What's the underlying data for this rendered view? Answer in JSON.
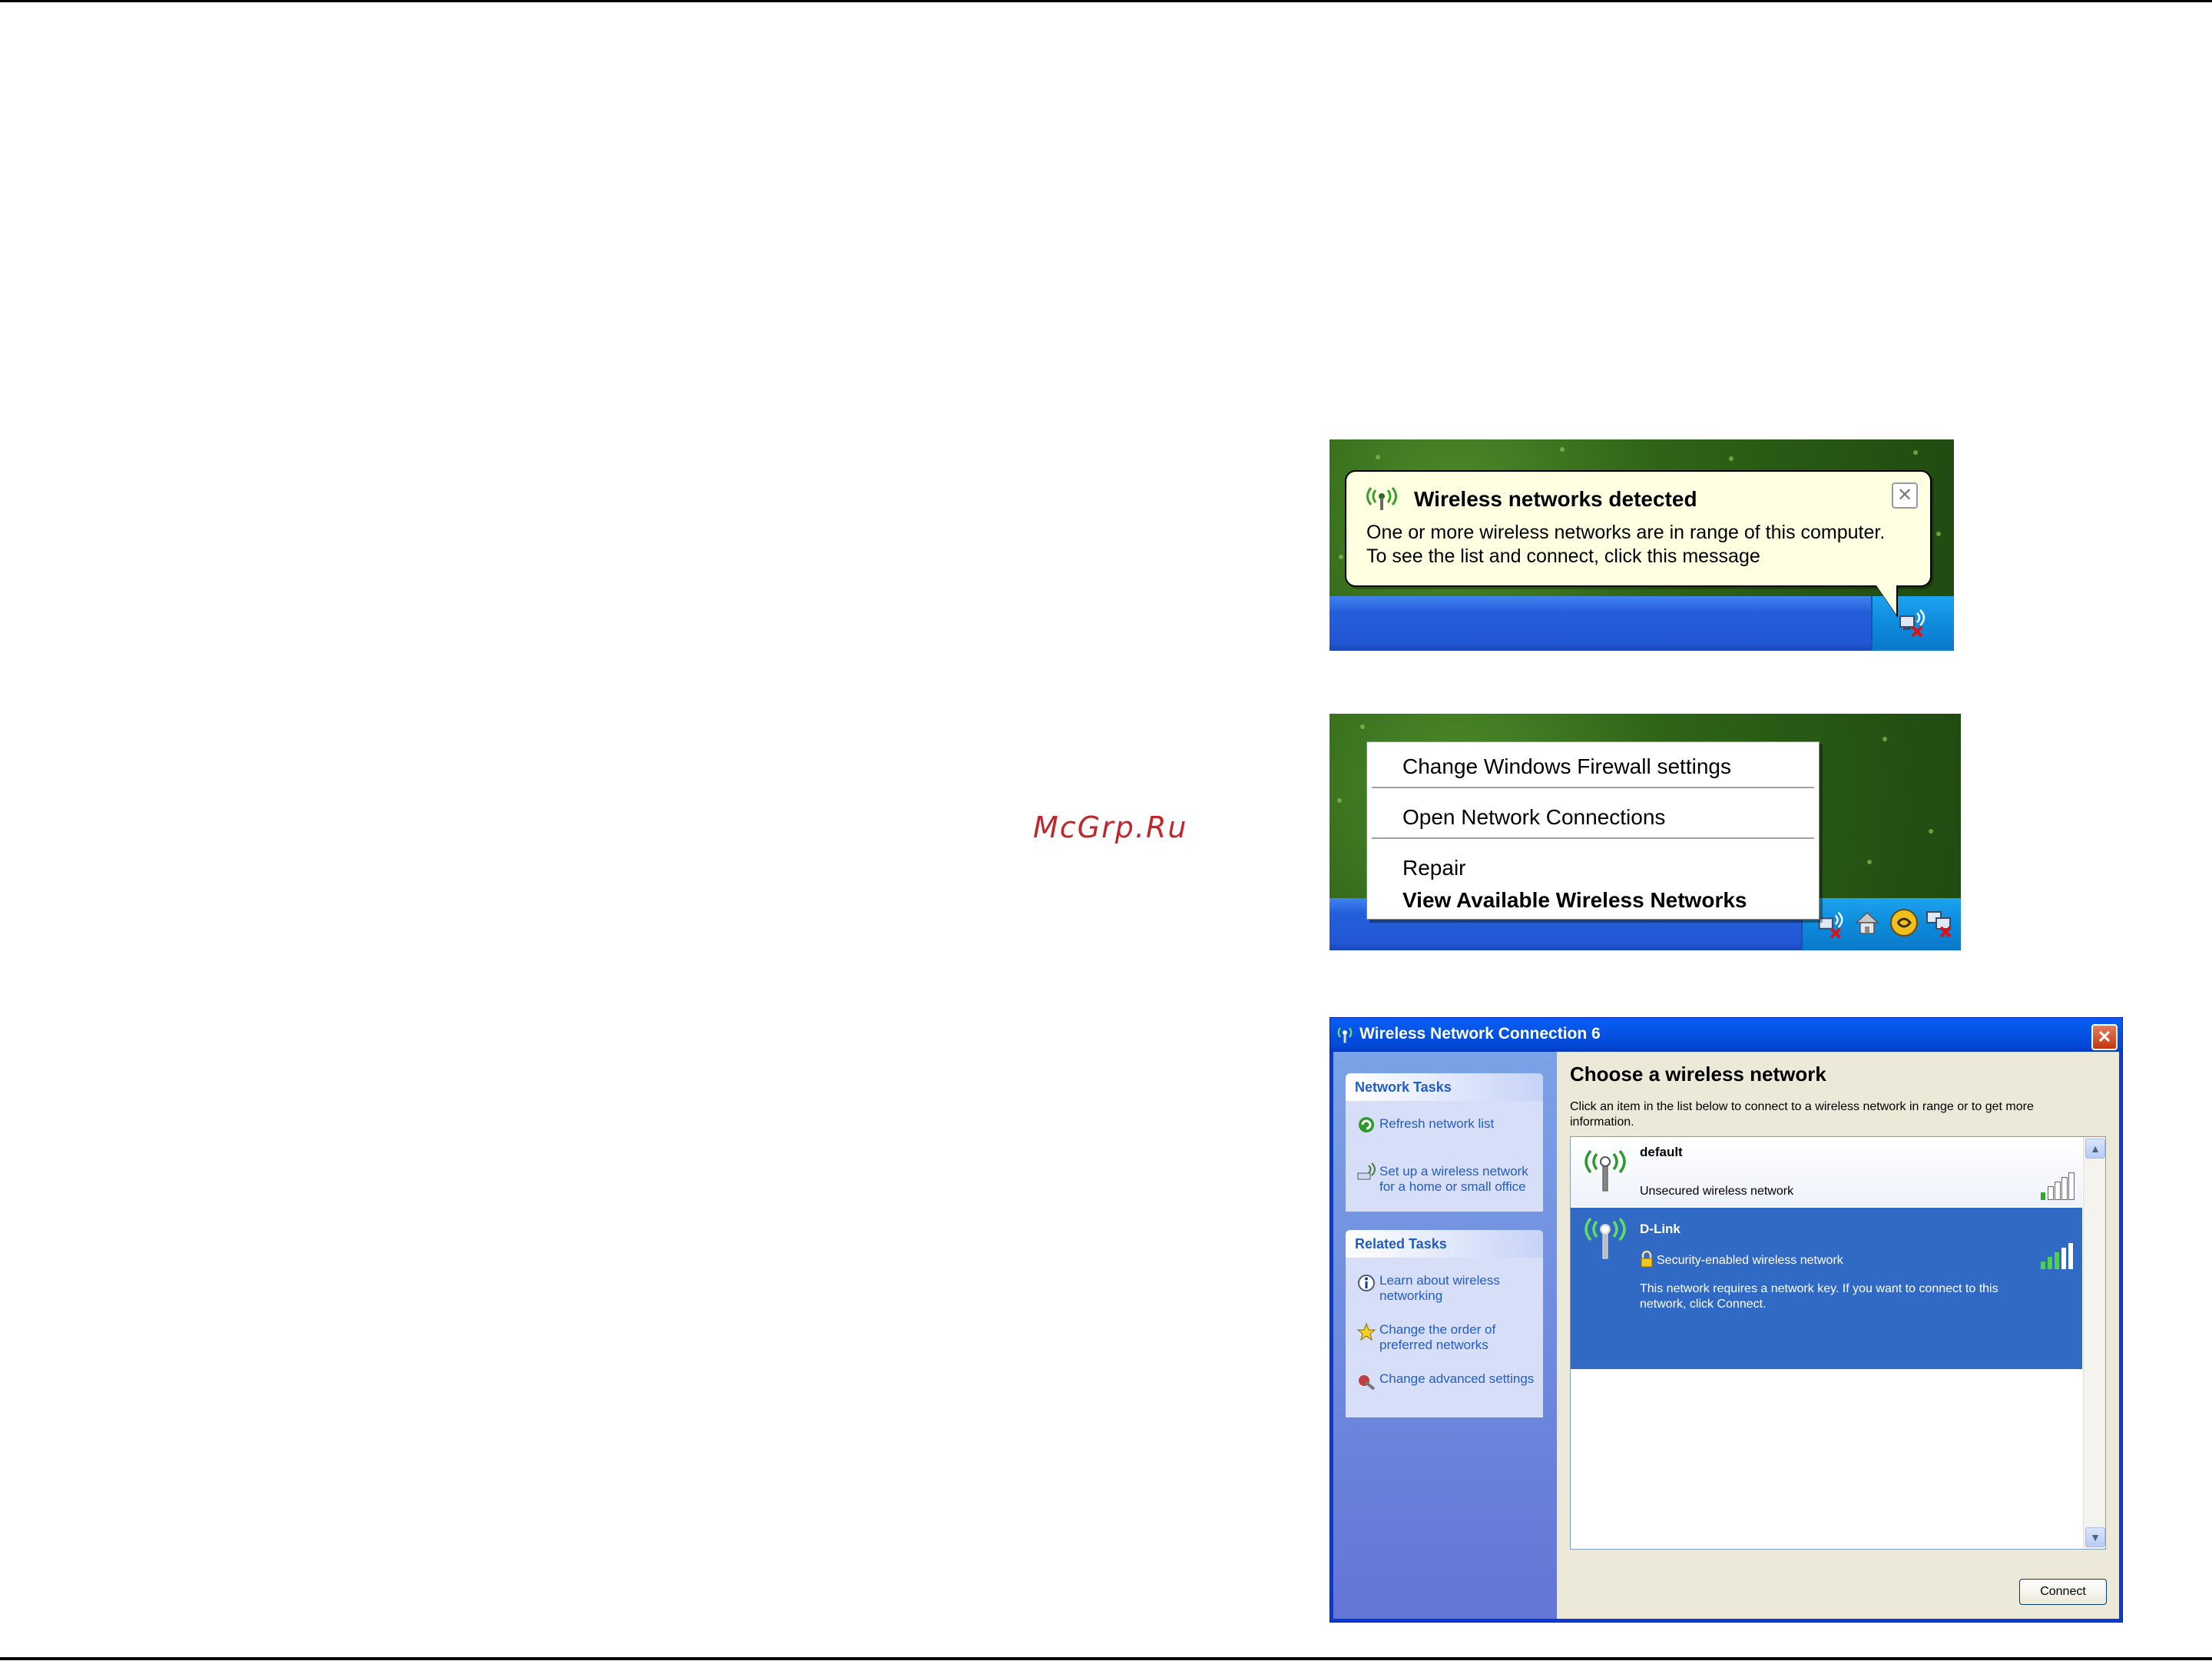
{
  "watermark": "McGrp.Ru",
  "balloon": {
    "title": "Wireless networks detected",
    "message_line1": "One or more wireless networks are in range of this computer.",
    "message_line2": "To see the list and connect, click this message",
    "close_label": "✕"
  },
  "context_menu": {
    "items": [
      {
        "label": "Change Windows Firewall settings",
        "bold": false
      },
      {
        "label": "Open Network Connections",
        "bold": false
      },
      {
        "label": "Repair",
        "bold": false
      },
      {
        "label": "View Available Wireless Networks",
        "bold": true
      }
    ]
  },
  "dialog": {
    "title": "Wireless Network Connection 6",
    "close_label": "✕",
    "network_tasks": {
      "header": "Network Tasks",
      "items": [
        {
          "label": "Refresh network list",
          "icon": "refresh-icon"
        },
        {
          "label": "Set up a wireless network for a home or small office",
          "icon": "wireless-setup-icon"
        }
      ]
    },
    "related_tasks": {
      "header": "Related Tasks",
      "items": [
        {
          "label": "Learn about wireless networking",
          "icon": "info-icon"
        },
        {
          "label": "Change the order of preferred networks",
          "icon": "star-icon"
        },
        {
          "label": "Change advanced settings",
          "icon": "settings-icon"
        }
      ]
    },
    "heading": "Choose a wireless network",
    "description": "Click an item in the list below to connect to a wireless network in range or to get more information.",
    "networks": [
      {
        "name": "default",
        "status": "Unsecured wireless network",
        "signal_bars": 1,
        "selected": false
      },
      {
        "name": "D-Link",
        "status": "Security-enabled wireless network",
        "detail": "This network requires a network key. If you want to connect to this network, click Connect.",
        "signal_bars": 3,
        "selected": true
      }
    ],
    "connect_label": "Connect"
  },
  "colors": {
    "xp_blue": "#245edb",
    "selection_blue": "#316ac5",
    "balloon_yellow": "#ffffe1",
    "link_blue": "#215dc6",
    "watermark_red": "#c0272d"
  }
}
